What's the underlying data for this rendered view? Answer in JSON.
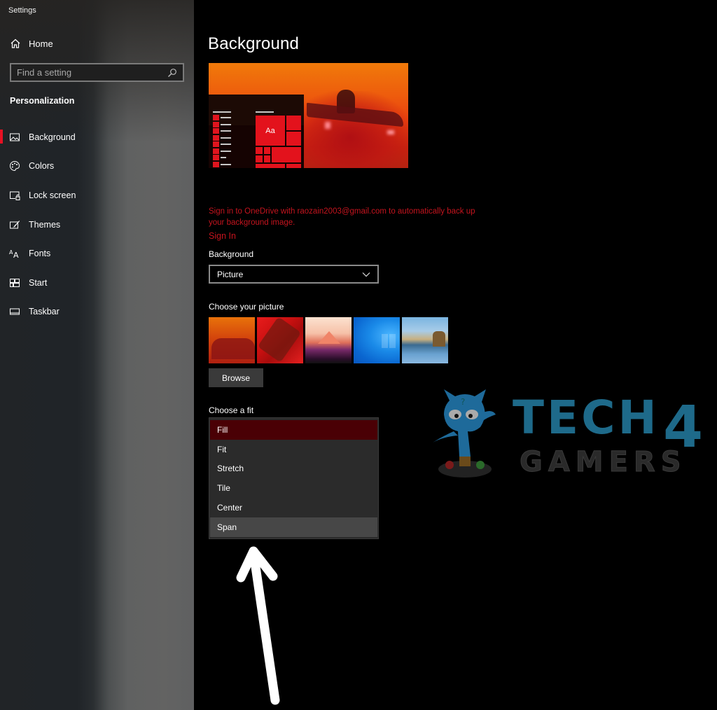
{
  "sidebar": {
    "app_title": "Settings",
    "home_label": "Home",
    "search_placeholder": "Find a setting",
    "section_title": "Personalization",
    "items": [
      {
        "label": "Background",
        "icon": "picture-icon",
        "active": true
      },
      {
        "label": "Colors",
        "icon": "palette-icon",
        "active": false
      },
      {
        "label": "Lock screen",
        "icon": "lock-screen-icon",
        "active": false
      },
      {
        "label": "Themes",
        "icon": "themes-icon",
        "active": false
      },
      {
        "label": "Fonts",
        "icon": "fonts-icon",
        "active": false
      },
      {
        "label": "Start",
        "icon": "start-icon",
        "active": false
      },
      {
        "label": "Taskbar",
        "icon": "taskbar-icon",
        "active": false
      }
    ]
  },
  "main": {
    "page_title": "Background",
    "preview": {
      "tile_text": "Aa"
    },
    "onedrive_message": "Sign in to OneDrive with raozain2003@gmail.com to automatically back up your background image.",
    "sign_in_link": "Sign In",
    "background_label": "Background",
    "background_value": "Picture",
    "choose_picture_label": "Choose your picture",
    "pictures": [
      "picture-1",
      "picture-2",
      "picture-3",
      "picture-4",
      "picture-5"
    ],
    "browse_label": "Browse",
    "choose_fit_label": "Choose a fit",
    "fit_options": [
      {
        "label": "Fill",
        "state": "selected"
      },
      {
        "label": "Fit",
        "state": "normal"
      },
      {
        "label": "Stretch",
        "state": "normal"
      },
      {
        "label": "Tile",
        "state": "normal"
      },
      {
        "label": "Center",
        "state": "normal"
      },
      {
        "label": "Span",
        "state": "hover"
      }
    ]
  },
  "watermark": {
    "line1": "TECH",
    "line1_number": "4",
    "line2": "GAMERS"
  },
  "colors": {
    "accent": "#e81123",
    "warning_text": "#c5141e",
    "fill_selected": "#4a0005",
    "span_hover": "#474747"
  }
}
